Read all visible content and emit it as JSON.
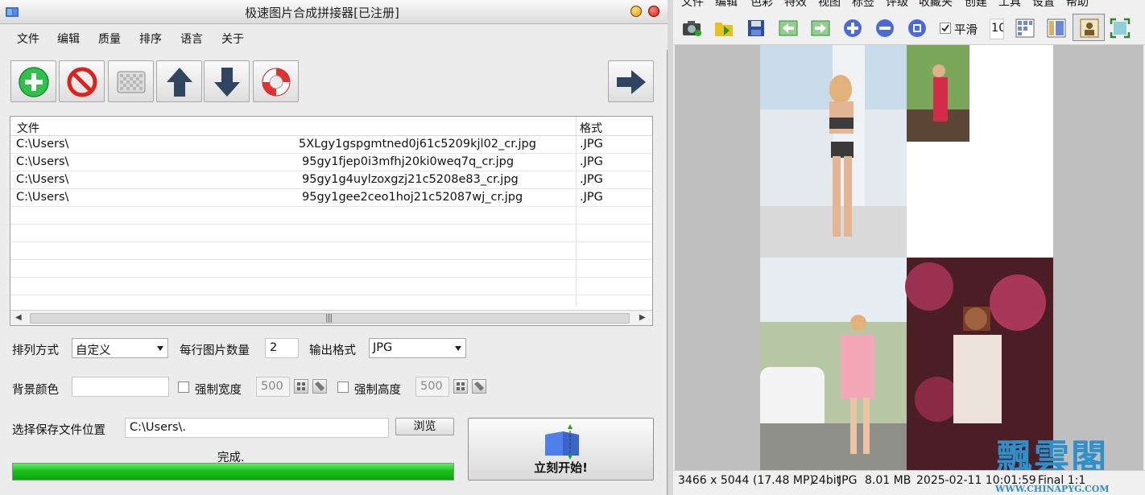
{
  "left_window": {
    "title": "极速图片合成拼接器[已注册]",
    "menu": [
      "文件",
      "编辑",
      "质量",
      "排序",
      "语言",
      "关于"
    ],
    "toolbar": {
      "add_icon": "plus-circle-icon",
      "remove_icon": "no-entry-icon",
      "clear_icon": "checker-grid-icon",
      "up_icon": "arrow-up-icon",
      "down_icon": "arrow-down-icon",
      "help_icon": "lifebuoy-icon",
      "next_icon": "arrow-right-icon"
    },
    "file_list": {
      "col_file": "文件",
      "col_format": "格式",
      "rows": [
        {
          "path_start": "C:\\Users\\",
          "path_end": "5XLgy1gspgmtned0j61c5209kjl02_cr.jpg",
          "format": ".JPG"
        },
        {
          "path_start": "C:\\Users\\",
          "path_end": "95gy1fjep0i3mfhj20ki0weq7q_cr.jpg",
          "format": ".JPG"
        },
        {
          "path_start": "C:\\Users\\",
          "path_end": "95gy1g4uylzoxgzj21c5208e83_cr.jpg",
          "format": ".JPG"
        },
        {
          "path_start": "C:\\Users\\",
          "path_end": "95gy1gee2ceo1hoj21c52087wj_cr.jpg",
          "format": ".JPG"
        }
      ],
      "scroll_grip": "|||"
    },
    "options": {
      "arrange_label": "排列方式",
      "arrange_value": "自定义",
      "per_row_label": "每行图片数量",
      "per_row_value": "2",
      "output_format_label": "输出格式",
      "output_format_value": "JPG",
      "bg_color_label": "背景颜色",
      "force_width_label": "强制宽度",
      "force_width_value": "500",
      "force_height_label": "强制高度",
      "force_height_value": "500"
    },
    "save": {
      "label": "选择保存文件位置",
      "path": "C:\\Users\\.",
      "browse_button": "浏览"
    },
    "status_text": "完成.",
    "progress_percent": 100,
    "start_button": "立刻开始!"
  },
  "right_window": {
    "menu": [
      "文件",
      "编辑",
      "色彩",
      "特效",
      "视图",
      "标签",
      "评级",
      "收藏夹",
      "创建",
      "工具",
      "设置",
      "帮助"
    ],
    "smooth_label": "平滑",
    "zoom_field": "10",
    "status": {
      "dimensions": "3466 x 5044 (17.48 MP)",
      "bitdepth": "24bit",
      "format": "JPG",
      "size": "8.01 MB",
      "datetime": "2025-02-11 10:01:59",
      "extra": "Final 1:1"
    },
    "watermark_text": "飄雲閣",
    "watermark_url": "WWW.CHINAPYG.COM"
  },
  "colors": {
    "progress_green": "#1bbf1b",
    "accent_blue": "#2f8fc8"
  }
}
